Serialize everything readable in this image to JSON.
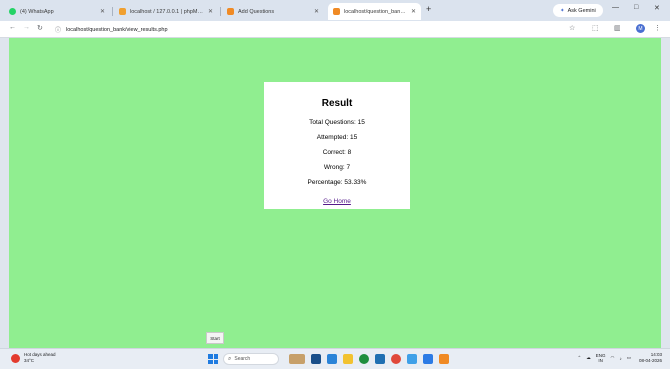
{
  "browser": {
    "tabs": [
      {
        "title": "(4) WhatsApp",
        "color": "#25d366",
        "active": false
      },
      {
        "title": "localhost / 127.0.0.1 | phpMyAdmin",
        "color": "#f0a030",
        "active": false
      },
      {
        "title": "Add Questions",
        "color": "#f08a24",
        "active": false
      },
      {
        "title": "localhost/question_bank/view_results.php",
        "color": "#f08a24",
        "active": true
      }
    ],
    "new_tab": "+",
    "gemini_label": "Ask Gemini",
    "window_controls": {
      "minimize": "—",
      "maximize": "□",
      "close": "✕"
    },
    "url": "localhost/question_bank/view_results.php",
    "profile_initial": "M"
  },
  "result": {
    "heading": "Result",
    "total_questions": "Total Questions: 15",
    "attempted": "Attempted: 15",
    "correct": "Correct: 8",
    "wrong": "Wrong: 7",
    "percentage": "Percentage: 53.33%",
    "home_link": "Go Home"
  },
  "start_popup": "Start",
  "taskbar": {
    "weather_line1": "Hot days ahead",
    "weather_line2": "34°C",
    "search_placeholder": "Search",
    "app_colors": [
      "#c7a06a",
      "#1a4f8a",
      "#2b84d8",
      "#f2c230",
      "#1e8e3e",
      "#1f6fb2",
      "#e0483a",
      "#3fa0e8",
      "#2c7be5",
      "#f08a24"
    ],
    "lang_top": "ENG",
    "lang_bottom": "IN",
    "time": "14:03",
    "date": "08-04-2026"
  },
  "colors": {
    "page_bg": "#90ee90",
    "card_bg": "#ffffff",
    "link": "#551a8b"
  }
}
